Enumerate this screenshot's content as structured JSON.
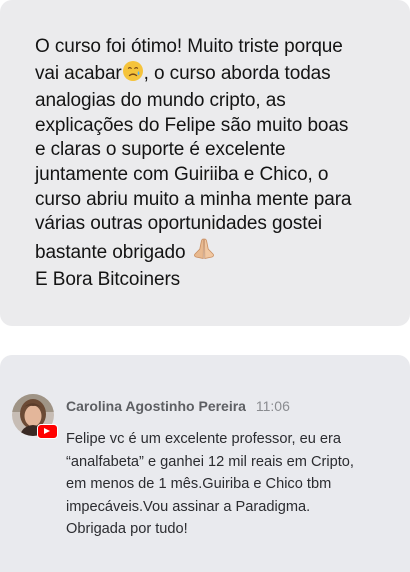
{
  "post": {
    "lines": [
      "O curso foi ótimo! Muito triste porque",
      ", o curso aborda todas",
      "analogias do mundo cripto, as",
      "explicações do Felipe são muito boas",
      "e claras o suporte é excelente",
      "juntamente com Guiriiba e Chico, o",
      "curso abriu muito a minha mente para",
      "várias outras oportunidades gostei",
      "bastante obrigado",
      "E Bora Bitcoiners"
    ],
    "line2_prefix": "vai acabar",
    "emoji_1": "crying-face-icon",
    "emoji_2": "folded-hands-icon"
  },
  "comment": {
    "author": "Carolina Agostinho Pereira",
    "time": "11:06",
    "lines": [
      "Felipe vc é um excelente professor, eu era",
      "“analfabeta” e ganhei 12 mil reais em Cripto,",
      "em menos de 1 mês.Guiriba e Chico tbm",
      "impecáveis.Vou assinar a Paradigma.",
      "Obrigada por tudo!"
    ],
    "badge_icon": "youtube-icon"
  },
  "colors": {
    "card_bg": "#ebebed",
    "text": "#141414",
    "author": "#5d5f63",
    "time": "#8a8c90",
    "youtube_red": "#ff0000"
  }
}
